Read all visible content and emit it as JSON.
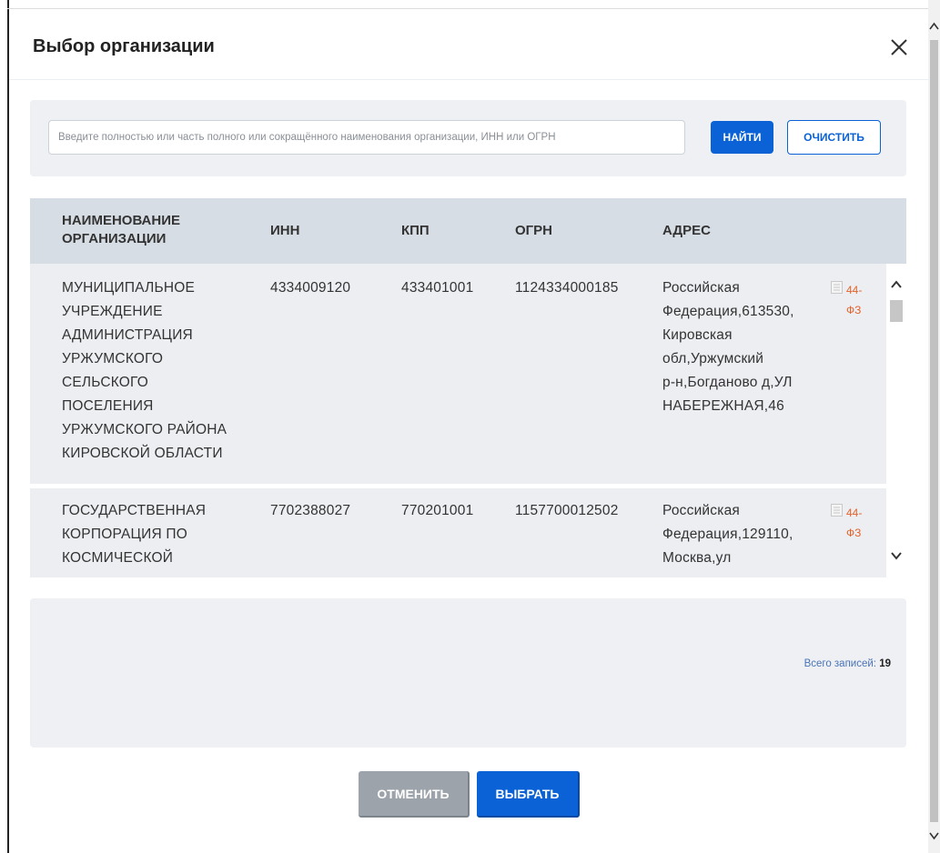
{
  "dialog": {
    "title": "Выбор организации",
    "close_icon": "close-icon"
  },
  "search": {
    "placeholder": "Введите полностью или часть полного или сокращённого наименования организации, ИНН или ОГРН",
    "value": "",
    "find_label": "НАЙТИ",
    "clear_label": "ОЧИСТИТЬ"
  },
  "table": {
    "headers": {
      "name_line1": "НАИМЕНОВАНИЕ",
      "name_line2": "ОРГАНИЗАЦИИ",
      "inn": "ИНН",
      "kpp": "КПП",
      "ogrn": "ОГРН",
      "address": "АДРЕС"
    },
    "rows": [
      {
        "name_lines": [
          "МУНИЦИПАЛЬНОЕ",
          "УЧРЕЖДЕНИЕ",
          "АДМИНИСТРАЦИЯ",
          "УРЖУМСКОГО",
          "СЕЛЬСКОГО",
          "ПОСЕЛЕНИЯ",
          "УРЖУМСКОГО РАЙОНА",
          "КИРОВСКОЙ ОБЛАСТИ"
        ],
        "inn": "4334009120",
        "kpp": "433401001",
        "ogrn": "1124334000185",
        "address_lines": [
          "Российская",
          "Федерация,613530,",
          "Кировская",
          "обл,Уржумский",
          "р-н,Богданово д,УЛ",
          "НАБЕРЕЖНАЯ,46"
        ],
        "law_lines": [
          "44-",
          "ФЗ"
        ]
      },
      {
        "name_lines": [
          "ГОСУДАРСТВЕННАЯ",
          "КОРПОРАЦИЯ ПО",
          "КОСМИЧЕСКОЙ"
        ],
        "inn": "7702388027",
        "kpp": "770201001",
        "ogrn": "1157700012502",
        "address_lines": [
          "Российская",
          "Федерация,129110,",
          "Москва,ул"
        ],
        "law_lines": [
          "44-",
          "ФЗ"
        ]
      }
    ]
  },
  "footer": {
    "total_label": "Всего записей:",
    "total_value": "19"
  },
  "actions": {
    "cancel_label": "ОТМЕНИТЬ",
    "select_label": "ВЫБРАТЬ"
  },
  "colors": {
    "primary": "#0a62d6",
    "law_link": "#e2622c",
    "header_bg": "#d7dde4",
    "row_bg": "#eceef1",
    "panel_bg": "#eef0f3",
    "cancel_bg": "#9ca3ab"
  }
}
